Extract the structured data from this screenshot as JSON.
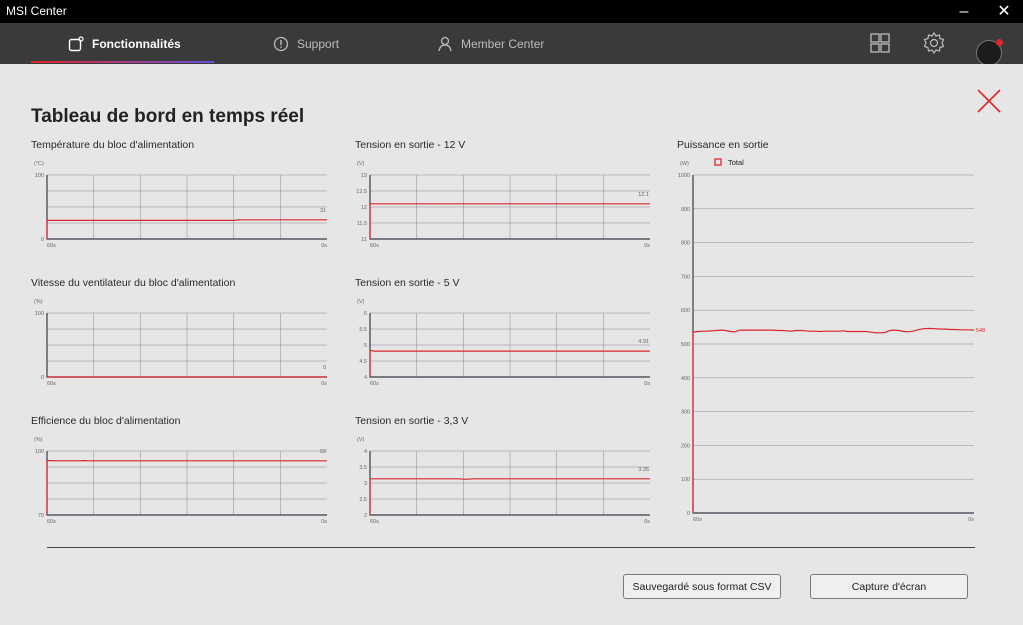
{
  "window": {
    "title": "MSI Center",
    "minimize": "–",
    "close": "✕"
  },
  "nav": {
    "tabs": [
      {
        "label": "Fonctionnalités",
        "icon": "features-icon",
        "active": true
      },
      {
        "label": "Support",
        "icon": "support-icon",
        "active": false
      },
      {
        "label": "Member Center",
        "icon": "user-icon",
        "active": false
      }
    ],
    "right_icons": [
      "grid-icon",
      "settings-icon",
      "avatar"
    ]
  },
  "page": {
    "title": "Tableau de bord en temps réel"
  },
  "colors": {
    "accent": "#e0262d",
    "line": "#d9262d",
    "grid": "#8a8a9a",
    "axis": "#3a3a4a"
  },
  "chart_data": [
    {
      "type": "line",
      "title": "Température du bloc d'alimentation",
      "unit": "(°C)",
      "yticks": [
        "100",
        "0"
      ],
      "ylim": [
        0,
        100
      ],
      "xticks": [
        "60s",
        "0s"
      ],
      "series": [
        {
          "values": [
            29,
            29,
            29,
            29,
            29,
            29,
            29,
            29,
            29,
            29,
            29,
            29,
            29,
            29,
            29,
            29,
            29,
            29,
            29,
            29,
            29,
            29,
            29,
            29,
            29,
            29,
            29,
            29,
            29,
            29,
            29,
            29,
            29,
            29,
            29,
            29,
            29,
            29,
            29,
            29,
            29,
            30,
            30,
            30,
            30,
            30,
            30,
            30,
            30,
            30,
            30,
            30,
            30,
            30,
            30,
            30,
            30,
            30,
            30,
            30,
            30
          ]
        }
      ],
      "current": "31"
    },
    {
      "type": "line",
      "title": "Tension en sortie - 12 V",
      "unit": "(V)",
      "yticks": [
        "13",
        "12.5",
        "12",
        "11.5",
        "11"
      ],
      "ylim": [
        11,
        13
      ],
      "xticks": [
        "60s",
        "0s"
      ],
      "series": [
        {
          "values": [
            12.1,
            12.1,
            12.1,
            12.1,
            12.1,
            12.1,
            12.1,
            12.1,
            12.1,
            12.1,
            12.1,
            12.1,
            12.1,
            12.1,
            12.1,
            12.1,
            12.1,
            12.1,
            12.1,
            12.1,
            12.1,
            12.1,
            12.1,
            12.1,
            12.1,
            12.1,
            12.1,
            12.1,
            12.1,
            12.1,
            12.1,
            12.1,
            12.1,
            12.1,
            12.1,
            12.1,
            12.1,
            12.1,
            12.1,
            12.1,
            12.1,
            12.1,
            12.1,
            12.1,
            12.1,
            12.1,
            12.1,
            12.1,
            12.1,
            12.1,
            12.1,
            12.1,
            12.1,
            12.1,
            12.1,
            12.1,
            12.1,
            12.1,
            12.1,
            12.1,
            12.1
          ]
        }
      ],
      "current": "12.1"
    },
    {
      "type": "line",
      "title": "Puissance en sortie",
      "unit": "(W)",
      "yticks": [
        "1000",
        "900",
        "800",
        "700",
        "600",
        "500",
        "400",
        "300",
        "200",
        "100",
        "0"
      ],
      "ylim": [
        0,
        1000
      ],
      "xticks": [
        "60s",
        "0s"
      ],
      "legend": "Total",
      "series": [
        {
          "name": "Total",
          "values": [
            535,
            537,
            538,
            538,
            539,
            540,
            541,
            540,
            537,
            536,
            541,
            541,
            541,
            541,
            541,
            541,
            541,
            541,
            540,
            540,
            539,
            538,
            540,
            540,
            539,
            538,
            538,
            537,
            538,
            538,
            538,
            538,
            539,
            537,
            537,
            537,
            537,
            537,
            535,
            533,
            533,
            534,
            540,
            541,
            540,
            537,
            536,
            538,
            542,
            545,
            546,
            546,
            545,
            544,
            544,
            543,
            543,
            542,
            542,
            542,
            541
          ]
        }
      ],
      "current": "548"
    },
    {
      "type": "line",
      "title": "Vitesse du ventilateur du bloc d'alimentation",
      "unit": "(%)",
      "yticks": [
        "100",
        "0"
      ],
      "ylim": [
        0,
        100
      ],
      "xticks": [
        "60s",
        "0s"
      ],
      "series": [
        {
          "values": [
            0,
            0,
            0,
            0,
            0,
            0,
            0,
            0,
            0,
            0,
            0,
            0,
            0,
            0,
            0,
            0,
            0,
            0,
            0,
            0,
            0,
            0,
            0,
            0,
            0,
            0,
            0,
            0,
            0,
            0,
            0,
            0,
            0,
            0,
            0,
            0,
            0,
            0,
            0,
            0,
            0,
            0,
            0,
            0,
            0,
            0,
            0,
            0,
            0,
            0,
            0,
            0,
            0,
            0,
            0,
            0,
            0,
            0,
            0,
            0,
            0
          ]
        }
      ],
      "current": "0"
    },
    {
      "type": "line",
      "title": "Tension en sortie - 5 V",
      "unit": "(V)",
      "yticks": [
        "6",
        "5.5",
        "5",
        "4.5",
        "4"
      ],
      "ylim": [
        4,
        6
      ],
      "xticks": [
        "60s",
        "0s"
      ],
      "series": [
        {
          "values": [
            4.83,
            4.81,
            4.81,
            4.81,
            4.81,
            4.81,
            4.81,
            4.81,
            4.81,
            4.81,
            4.81,
            4.81,
            4.81,
            4.81,
            4.81,
            4.81,
            4.81,
            4.81,
            4.81,
            4.81,
            4.81,
            4.81,
            4.81,
            4.81,
            4.81,
            4.81,
            4.81,
            4.81,
            4.81,
            4.81,
            4.81,
            4.81,
            4.81,
            4.81,
            4.81,
            4.81,
            4.81,
            4.81,
            4.81,
            4.81,
            4.81,
            4.81,
            4.81,
            4.81,
            4.81,
            4.81,
            4.81,
            4.81,
            4.81,
            4.81,
            4.81,
            4.81,
            4.81,
            4.81,
            4.81,
            4.81,
            4.81,
            4.81,
            4.81,
            4.81,
            4.81
          ]
        }
      ],
      "current": "4.91"
    },
    {
      "type": "line",
      "title": "Efficience du bloc d'alimentation",
      "unit": "(%)",
      "yticks": [
        "100",
        "70"
      ],
      "ylim": [
        70,
        100
      ],
      "xticks": [
        "60s",
        "0s"
      ],
      "series": [
        {
          "values": [
            95.5,
            95.5,
            95.4,
            95.4,
            95.4,
            95.4,
            95.4,
            95.4,
            95.5,
            95.4,
            95.4,
            95.4,
            95.4,
            95.4,
            95.4,
            95.4,
            95.4,
            95.4,
            95.4,
            95.4,
            95.4,
            95.4,
            95.4,
            95.4,
            95.4,
            95.4,
            95.4,
            95.4,
            95.4,
            95.4,
            95.4,
            95.4,
            95.4,
            95.4,
            95.4,
            95.4,
            95.4,
            95.4,
            95.4,
            95.4,
            95.4,
            95.4,
            95.4,
            95.4,
            95.4,
            95.4,
            95.4,
            95.4,
            95.4,
            95.4,
            95.4,
            95.4,
            95.4,
            95.4,
            95.4,
            95.4,
            95.4,
            95.4,
            95.4,
            95.4,
            95.4
          ]
        }
      ],
      "current": "93"
    },
    {
      "type": "line",
      "title": "Tension en sortie - 3,3 V",
      "unit": "(V)",
      "yticks": [
        "4",
        "3.5",
        "3",
        "2.5",
        "2"
      ],
      "ylim": [
        2,
        4
      ],
      "xticks": [
        "60s",
        "0s"
      ],
      "series": [
        {
          "values": [
            3.13,
            3.13,
            3.13,
            3.13,
            3.13,
            3.13,
            3.13,
            3.13,
            3.13,
            3.13,
            3.13,
            3.13,
            3.13,
            3.13,
            3.13,
            3.13,
            3.13,
            3.13,
            3.13,
            3.13,
            3.12,
            3.12,
            3.13,
            3.13,
            3.13,
            3.13,
            3.13,
            3.13,
            3.13,
            3.13,
            3.13,
            3.13,
            3.13,
            3.13,
            3.13,
            3.13,
            3.13,
            3.13,
            3.13,
            3.13,
            3.13,
            3.13,
            3.13,
            3.13,
            3.13,
            3.13,
            3.13,
            3.13,
            3.13,
            3.13,
            3.13,
            3.13,
            3.13,
            3.13,
            3.13,
            3.13,
            3.13,
            3.13,
            3.13,
            3.13,
            3.13
          ]
        }
      ],
      "current": "3.35"
    }
  ],
  "buttons": {
    "save_csv": "Sauvegardé sous format CSV",
    "screenshot": "Capture d'écran"
  }
}
